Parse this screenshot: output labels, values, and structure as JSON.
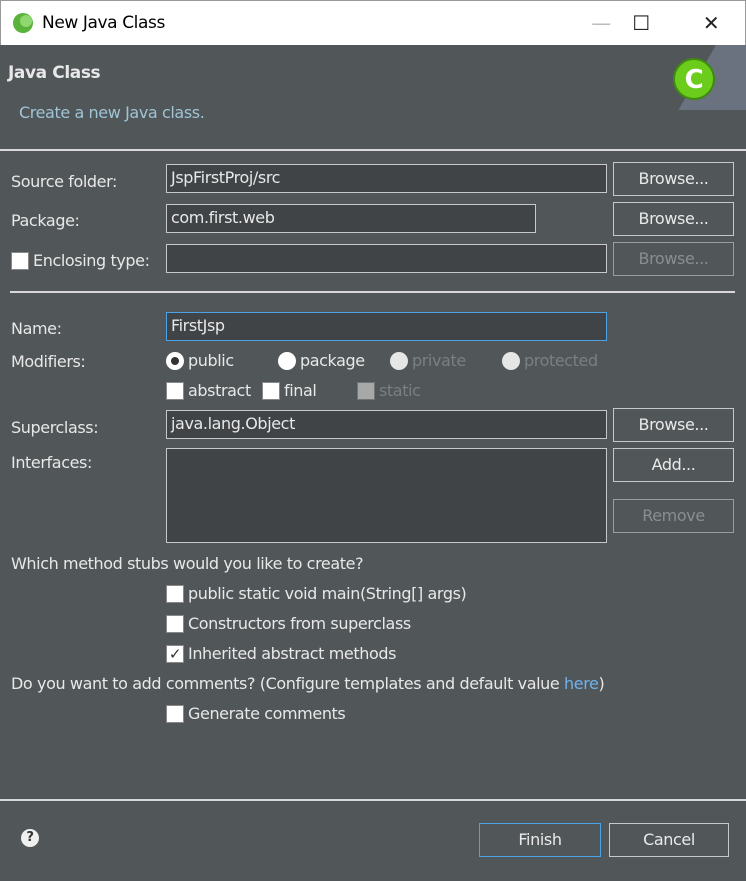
{
  "window": {
    "title": "New Java Class",
    "minimize": "—",
    "maximize": "☐",
    "close": "✕"
  },
  "header": {
    "title": "Java Class",
    "description": "Create a new Java class."
  },
  "form": {
    "source_folder": {
      "label": "Source folder:",
      "value": "JspFirstProj/src",
      "browse": "Browse..."
    },
    "package": {
      "label": "Package:",
      "value": "com.first.web",
      "browse": "Browse..."
    },
    "enclosing": {
      "label": "Enclosing type:",
      "value": "",
      "browse": "Browse...",
      "checked": false
    },
    "name": {
      "label": "Name:",
      "value": "FirstJsp"
    },
    "modifiers": {
      "label": "Modifiers:",
      "radios": [
        "public",
        "package",
        "private",
        "protected"
      ],
      "selected": "public",
      "checks": [
        "abstract",
        "final",
        "static"
      ]
    },
    "superclass": {
      "label": "Superclass:",
      "value": "java.lang.Object",
      "browse": "Browse..."
    },
    "interfaces": {
      "label": "Interfaces:",
      "add": "Add...",
      "remove": "Remove"
    },
    "stubs_question": "Which method stubs would you like to create?",
    "stubs": [
      {
        "label": "public static void main(String[] args)",
        "checked": false
      },
      {
        "label": "Constructors from superclass",
        "checked": false
      },
      {
        "label": "Inherited abstract methods",
        "checked": true
      }
    ],
    "comments_question": "Do you want to add comments? (Configure templates and default value ",
    "comments_link": "here",
    "comments_close": ")",
    "generate_comments": {
      "label": "Generate comments",
      "checked": false
    }
  },
  "footer": {
    "help": "?",
    "finish": "Finish",
    "cancel": "Cancel"
  }
}
